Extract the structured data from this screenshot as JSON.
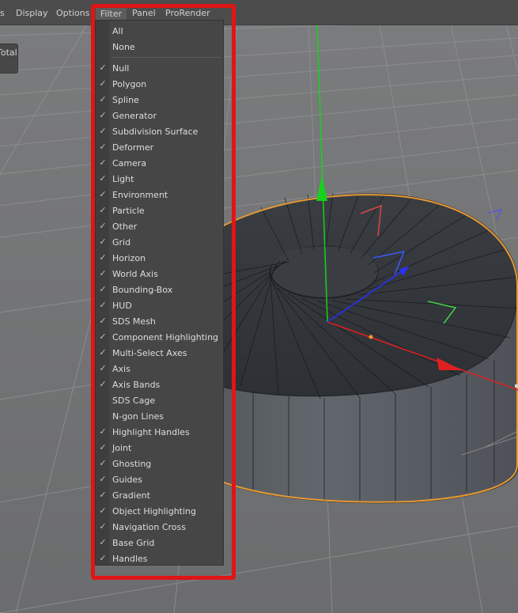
{
  "menubar": {
    "items": [
      "s",
      "Display",
      "Options",
      "Filter",
      "Panel",
      "ProRender"
    ]
  },
  "side_panel": {
    "label": "Total"
  },
  "filter_menu": {
    "top_items": [
      {
        "label": "All",
        "checked": false
      },
      {
        "label": "None",
        "checked": false
      }
    ],
    "items": [
      {
        "label": "Null",
        "checked": true
      },
      {
        "label": "Polygon",
        "checked": true
      },
      {
        "label": "Spline",
        "checked": true
      },
      {
        "label": "Generator",
        "checked": true
      },
      {
        "label": "Subdivision Surface",
        "checked": true
      },
      {
        "label": "Deformer",
        "checked": true
      },
      {
        "label": "Camera",
        "checked": true
      },
      {
        "label": "Light",
        "checked": true
      },
      {
        "label": "Environment",
        "checked": true
      },
      {
        "label": "Particle",
        "checked": true
      },
      {
        "label": "Other",
        "checked": true
      },
      {
        "label": "Grid",
        "checked": true
      },
      {
        "label": "Horizon",
        "checked": true
      },
      {
        "label": "World Axis",
        "checked": true
      },
      {
        "label": "Bounding-Box",
        "checked": true
      },
      {
        "label": "HUD",
        "checked": true
      },
      {
        "label": "SDS Mesh",
        "checked": true
      },
      {
        "label": "Component Highlighting",
        "checked": true
      },
      {
        "label": "Multi-Select Axes",
        "checked": true
      },
      {
        "label": "Axis",
        "checked": true
      },
      {
        "label": "Axis Bands",
        "checked": true
      },
      {
        "label": "SDS Cage",
        "checked": false
      },
      {
        "label": "N-gon Lines",
        "checked": false
      },
      {
        "label": "Highlight Handles",
        "checked": true
      },
      {
        "label": "Joint",
        "checked": true
      },
      {
        "label": "Ghosting",
        "checked": true
      },
      {
        "label": "Guides",
        "checked": true
      },
      {
        "label": "Gradient",
        "checked": true
      },
      {
        "label": "Object Highlighting",
        "checked": true
      },
      {
        "label": "Navigation Cross",
        "checked": true
      },
      {
        "label": "Base Grid",
        "checked": true
      },
      {
        "label": "Handles",
        "checked": true
      }
    ]
  },
  "colors": {
    "highlight": "#e01515",
    "axis_x": "#e02020",
    "axis_y": "#16d21b",
    "axis_z": "#2631ff",
    "selection_outline": "#f39a22"
  },
  "icons": {
    "check": "check-icon"
  }
}
